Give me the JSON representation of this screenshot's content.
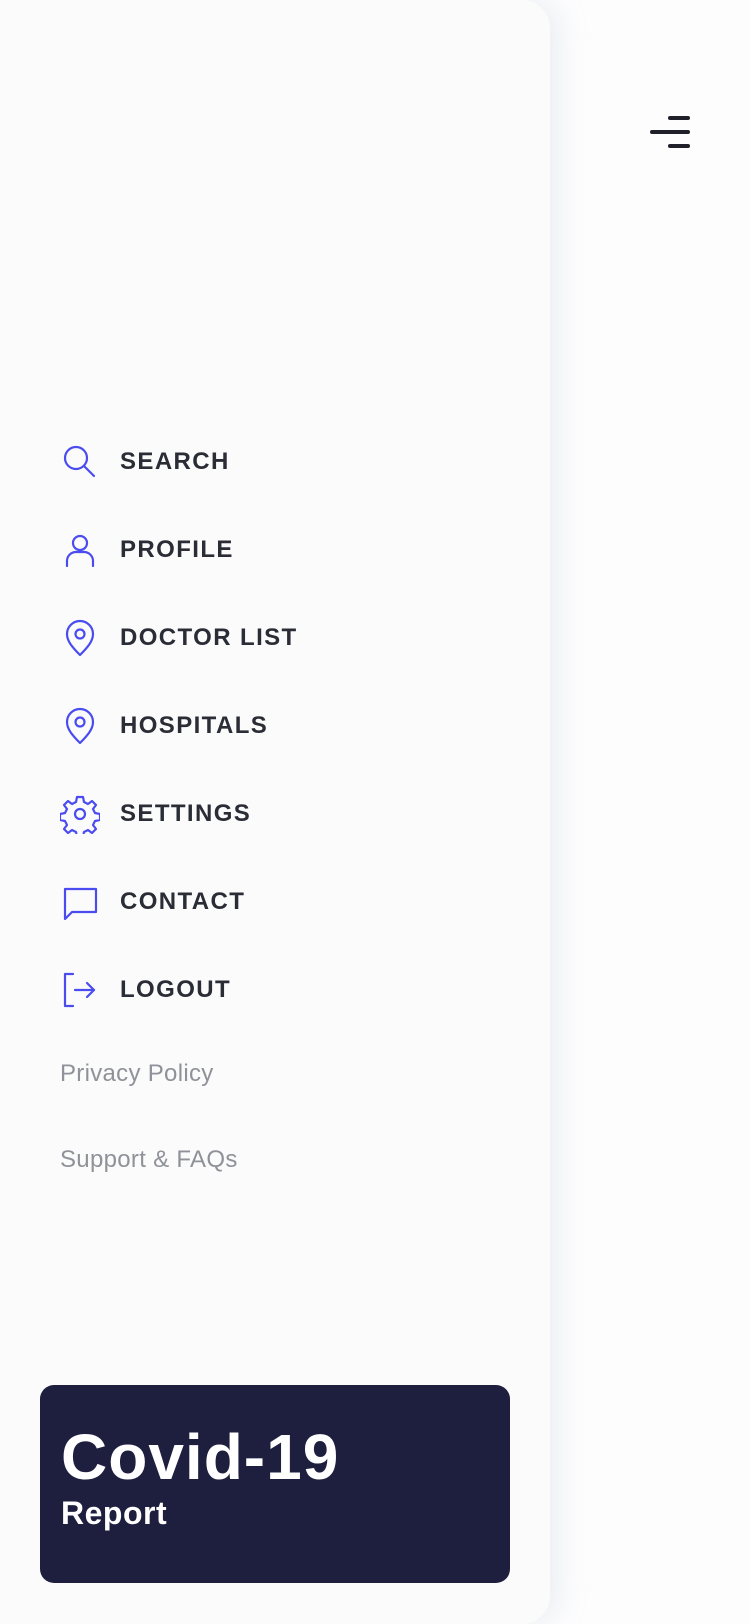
{
  "menu_toggle": {
    "icon": "menu-lines-icon"
  },
  "nav": {
    "items": [
      {
        "label": "SEARCH",
        "icon": "search-icon"
      },
      {
        "label": "PROFILE",
        "icon": "user-icon"
      },
      {
        "label": "DOCTOR LIST",
        "icon": "map-pin-icon"
      },
      {
        "label": "HOSPITALS",
        "icon": "map-pin-icon"
      },
      {
        "label": "SETTINGS",
        "icon": "gear-icon"
      },
      {
        "label": "CONTACT",
        "icon": "message-icon"
      },
      {
        "label": "LOGOUT",
        "icon": "logout-icon"
      }
    ]
  },
  "links": {
    "privacy": "Privacy Policy",
    "support": "Support & FAQs"
  },
  "report_card": {
    "title": "Covid-19",
    "subtitle": "Report"
  },
  "colors": {
    "accent": "#4a4cf0",
    "card_bg": "#1e1f3f",
    "text_dark": "#2b2d36",
    "text_muted": "#8f9298"
  }
}
